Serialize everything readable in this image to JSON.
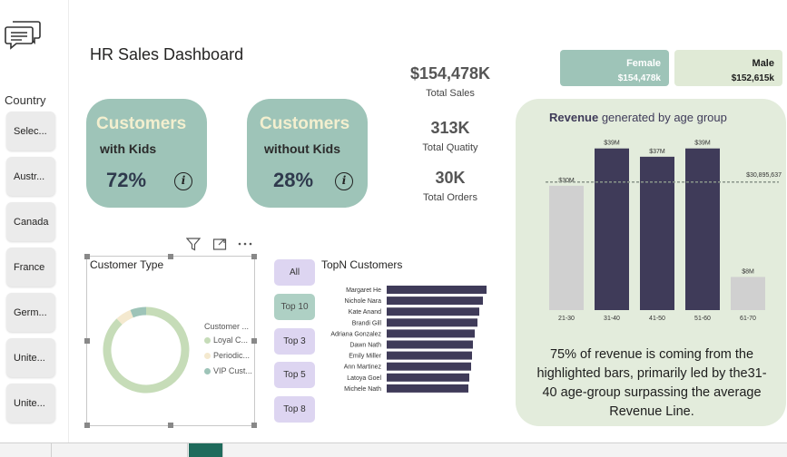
{
  "title": "HR Sales Dashboard",
  "slicer": {
    "label": "Country",
    "items": [
      "Selec...",
      "Austr...",
      "Canada",
      "France",
      "Germ...",
      "Unite...",
      "Unite..."
    ]
  },
  "kpi_cards": [
    {
      "heading": "Customers",
      "sub": "with Kids",
      "value": "72%"
    },
    {
      "heading": "Customers",
      "sub": "without Kids",
      "value": "28%"
    }
  ],
  "info_glyph": "i",
  "stats": [
    {
      "value": "$154,478K",
      "label": "Total Sales"
    },
    {
      "value": "313K",
      "label": "Total Quatity"
    },
    {
      "value": "30K",
      "label": "Total Orders"
    }
  ],
  "gender": {
    "female": {
      "label": "Female",
      "value": "$154,478k",
      "color": "#9ec4b8"
    },
    "male": {
      "label": "Male",
      "value": "$152,615k",
      "color": "#e0ead6"
    }
  },
  "age_panel": {
    "title_bold": "Revenue",
    "title_rest": " generated by age group",
    "average_label": "$30,895,637",
    "insight": "75% of revenue is coming from the highlighted bars, primarily led by the31-40 age-group surpassing the average Revenue Line."
  },
  "customer_type": {
    "title": "Customer Type",
    "legend_title": "Customer ...",
    "legend": [
      {
        "label": "Loyal C...",
        "color": "#c6dcb8"
      },
      {
        "label": "Periodic...",
        "color": "#f4e9cf"
      },
      {
        "label": "VIP Cust...",
        "color": "#9ec4b8"
      }
    ]
  },
  "topn": {
    "title": "TopN Customers",
    "buttons": [
      {
        "label": "All",
        "active": false
      },
      {
        "label": "Top 10",
        "active": true
      },
      {
        "label": "Top 3",
        "active": false
      },
      {
        "label": "Top 5",
        "active": false
      },
      {
        "label": "Top 8",
        "active": false
      }
    ]
  },
  "colors": {
    "accent_dark": "#3f3b59",
    "accent_gray": "#d0d0d0",
    "teal": "#9ec4b8",
    "sage": "#e3ecdc"
  },
  "chart_data": [
    {
      "type": "bar",
      "title": "Revenue generated by age group",
      "categories": [
        "21-30",
        "31-40",
        "41-50",
        "51-60",
        "61-70"
      ],
      "values": [
        30,
        39,
        37,
        39,
        8
      ],
      "value_labels": [
        "$30M",
        "$39M",
        "$37M",
        "$39M",
        "$8M"
      ],
      "highlighted": [
        false,
        true,
        true,
        true,
        false
      ],
      "average": 30.895637,
      "ylim": [
        0,
        42
      ],
      "xlabel": "",
      "ylabel": ""
    },
    {
      "type": "bar",
      "orientation": "horizontal",
      "title": "TopN Customers",
      "categories": [
        "Margaret He",
        "Nichole Nara",
        "Kate Anand",
        "Brandi Gill",
        "Adriana Gonzalez",
        "Dawn Nath",
        "Emily Miller",
        "Ann Martinez",
        "Latoya Goel",
        "Michele Nath"
      ],
      "values": [
        110,
        106,
        102,
        100,
        97,
        95,
        94,
        93,
        91,
        90
      ],
      "xlim": [
        0,
        110
      ],
      "xlabel": "",
      "ylabel": ""
    },
    {
      "type": "pie",
      "donut": true,
      "title": "Customer Type",
      "labels": [
        "Loyal C...",
        "Periodic...",
        "VIP Cust..."
      ],
      "values": [
        88,
        6,
        6
      ]
    }
  ]
}
